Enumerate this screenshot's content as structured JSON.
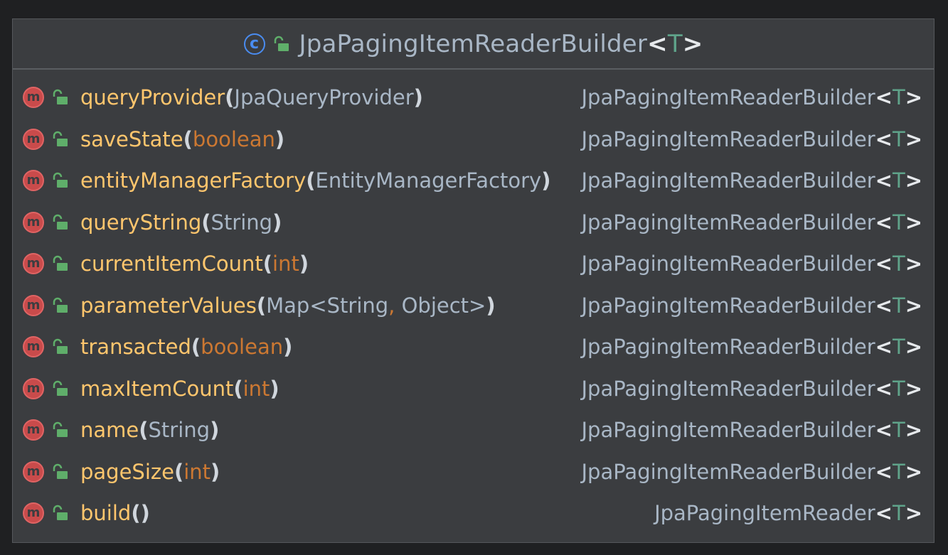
{
  "class_header": {
    "class_badge": "c",
    "icon": "class-icon",
    "visibility_icon": "public-lock-icon",
    "name": "JpaPagingItemReaderBuilder",
    "generic": "T"
  },
  "colors": {
    "method_name": "#ffc66d",
    "primitive_type": "#cc7832",
    "reference_type": "#a9b7c6",
    "generic_param": "#5fa38a",
    "method_badge": "#c94b4b",
    "class_badge": "#4a8cf0",
    "background": "#3b3d40"
  },
  "methods": [
    {
      "badge": "m",
      "name": "queryProvider",
      "params": [
        {
          "text": "JpaQueryProvider",
          "kind": "ref"
        }
      ],
      "return_type": "JpaPagingItemReaderBuilder",
      "return_generic": "T"
    },
    {
      "badge": "m",
      "name": "saveState",
      "params": [
        {
          "text": "boolean",
          "kind": "prim"
        }
      ],
      "return_type": "JpaPagingItemReaderBuilder",
      "return_generic": "T"
    },
    {
      "badge": "m",
      "name": "entityManagerFactory",
      "params": [
        {
          "text": "EntityManagerFactory",
          "kind": "ref"
        }
      ],
      "return_type": "JpaPagingItemReaderBuilder",
      "return_generic": "T"
    },
    {
      "badge": "m",
      "name": "queryString",
      "params": [
        {
          "text": "String",
          "kind": "ref"
        }
      ],
      "return_type": "JpaPagingItemReaderBuilder",
      "return_generic": "T"
    },
    {
      "badge": "m",
      "name": "currentItemCount",
      "params": [
        {
          "text": "int",
          "kind": "prim"
        }
      ],
      "return_type": "JpaPagingItemReaderBuilder",
      "return_generic": "T"
    },
    {
      "badge": "m",
      "name": "parameterValues",
      "params": [
        {
          "text": "Map<String",
          "kind": "ref"
        },
        {
          "text": ",",
          "kind": "comma"
        },
        {
          "text": " Object>",
          "kind": "ref"
        }
      ],
      "return_type": "JpaPagingItemReaderBuilder",
      "return_generic": "T"
    },
    {
      "badge": "m",
      "name": "transacted",
      "params": [
        {
          "text": "boolean",
          "kind": "prim"
        }
      ],
      "return_type": "JpaPagingItemReaderBuilder",
      "return_generic": "T"
    },
    {
      "badge": "m",
      "name": "maxItemCount",
      "params": [
        {
          "text": "int",
          "kind": "prim"
        }
      ],
      "return_type": "JpaPagingItemReaderBuilder",
      "return_generic": "T"
    },
    {
      "badge": "m",
      "name": "name",
      "params": [
        {
          "text": "String",
          "kind": "ref"
        }
      ],
      "return_type": "JpaPagingItemReaderBuilder",
      "return_generic": "T"
    },
    {
      "badge": "m",
      "name": "pageSize",
      "params": [
        {
          "text": "int",
          "kind": "prim"
        }
      ],
      "return_type": "JpaPagingItemReaderBuilder",
      "return_generic": "T"
    },
    {
      "badge": "m",
      "name": "build",
      "params": [],
      "return_type": "JpaPagingItemReader",
      "return_generic": "T"
    }
  ],
  "punctuation": {
    "open_paren": "(",
    "close_paren": ")",
    "lt": "<",
    "gt": ">"
  }
}
